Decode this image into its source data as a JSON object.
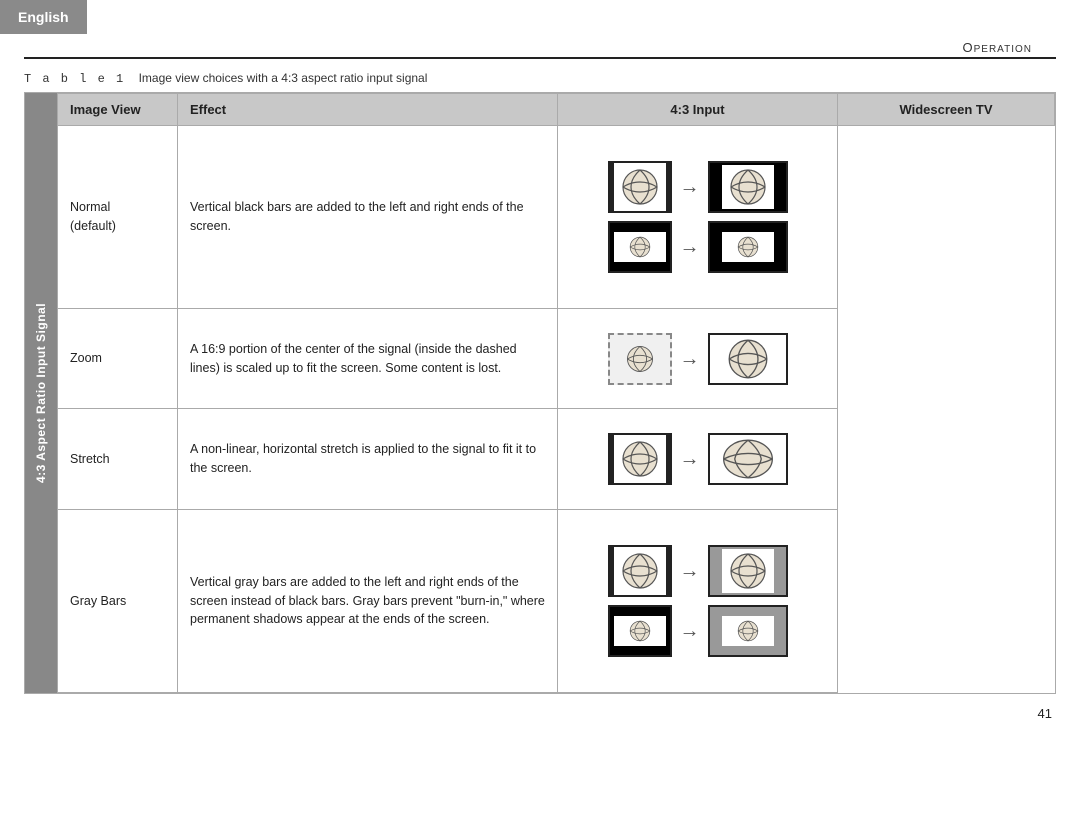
{
  "topTab": {
    "label": "English"
  },
  "header": {
    "section": "Operation"
  },
  "tableCaption": {
    "prefix": "Table 1",
    "text": "Image view choices with a 4:3 aspect ratio input signal"
  },
  "sideLabel": "4:3 Aspect Ratio Input Signal",
  "columns": {
    "imageView": "Image View",
    "effect": "Effect",
    "input43": "4:3 Input",
    "widescreenTV": "Widescreen TV"
  },
  "rows": [
    {
      "imageView": "Normal\n(default)",
      "effect": "Vertical black bars are added to the left and right ends of the screen.",
      "type": "normal"
    },
    {
      "imageView": "Zoom",
      "effect": "A 16:9 portion of the center of the signal (inside the dashed lines) is scaled up to fit the screen. Some content is lost.",
      "type": "zoom"
    },
    {
      "imageView": "Stretch",
      "effect": "A non-linear, horizontal stretch is applied to the signal to fit it to the screen.",
      "type": "stretch"
    },
    {
      "imageView": "Gray Bars",
      "effect": "Vertical gray bars are added to the left and right ends of the screen instead of black bars. Gray bars prevent \"burn-in,\" where permanent shadows appear at the ends of the screen.",
      "type": "graybars"
    }
  ],
  "pageNumber": "41"
}
